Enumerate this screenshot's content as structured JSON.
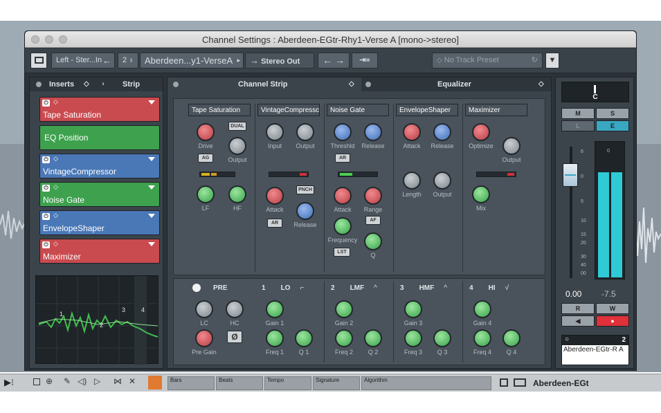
{
  "window": {
    "title": "Channel Settings : Aberdeen-EGtr-Rhy1-Verse A [mono->stereo]"
  },
  "toolbar": {
    "input_routing": "Left - Ster...In",
    "channel_number": "2",
    "channel_name": "Aberdeen...y1-VerseA",
    "output_routing": "Stereo Out",
    "track_preset": "No Track Preset"
  },
  "inserts_panel": {
    "tab_inserts": "Inserts",
    "tab_strip": "Strip",
    "slots": [
      {
        "name": "Tape Saturation",
        "color": "#c94a4f",
        "kind": "plugin"
      },
      {
        "name": "EQ Position",
        "color": "#3ea14e",
        "kind": "marker"
      },
      {
        "name": "VintageCompressor",
        "color": "#4a78b7",
        "kind": "plugin"
      },
      {
        "name": "Noise Gate",
        "color": "#3ea14e",
        "kind": "plugin"
      },
      {
        "name": "EnvelopeShaper",
        "color": "#4a78b7",
        "kind": "plugin"
      },
      {
        "name": "Maximizer",
        "color": "#c94a4f",
        "kind": "plugin"
      }
    ],
    "curve_points": [
      "1",
      "2",
      "3",
      "4"
    ]
  },
  "channel_strip": {
    "tab_label": "Channel Strip",
    "modules": [
      {
        "title": "Tape Saturation",
        "color": "#c94a4f",
        "knobs": [
          "Drive",
          "Output",
          "LF",
          "HF"
        ],
        "buttons": [
          "DUAL",
          "AG"
        ]
      },
      {
        "title": "VintageCompressc",
        "color": "#4a78b7",
        "knobs": [
          "Input",
          "Output",
          "Attack",
          "Release"
        ],
        "buttons": [
          "PNCH",
          "AR"
        ]
      },
      {
        "title": "Noise Gate",
        "color": "#3ea14e",
        "knobs": [
          "Threshld",
          "Release",
          "Attack",
          "Range",
          "Frequency",
          "Q"
        ],
        "buttons": [
          "AR",
          "AF",
          "LST"
        ]
      },
      {
        "title": "EnvelopeShaper",
        "color": "#4a78b7",
        "knobs": [
          "Attack",
          "Release",
          "Length",
          "Output"
        ],
        "buttons": []
      },
      {
        "title": "Maximizer",
        "color": "#c94a4f",
        "knobs": [
          "Optimize",
          "Output",
          "Mix"
        ],
        "buttons": []
      }
    ],
    "pre_section": {
      "label": "PRE",
      "knobs": [
        "LC",
        "HC",
        "Pre Gain"
      ],
      "phase_symbol": "Ø"
    },
    "eq_bands": [
      {
        "num": "1",
        "name": "LO",
        "knobs": [
          "Gain 1",
          "Freq 1",
          "Q 1"
        ]
      },
      {
        "num": "2",
        "name": "LMF",
        "knobs": [
          "Gain 2",
          "Freq 2",
          "Q 2"
        ]
      },
      {
        "num": "3",
        "name": "HMF",
        "knobs": [
          "Gain 3",
          "Freq 3",
          "Q 3"
        ]
      },
      {
        "num": "4",
        "name": "HI",
        "knobs": [
          "Gain 4",
          "Freq 4",
          "Q 4"
        ]
      }
    ]
  },
  "equalizer": {
    "tab_label": "Equalizer"
  },
  "fader_strip": {
    "pan_label": "C",
    "button_m": "M",
    "button_s": "S",
    "button_l": "L",
    "button_e": "E",
    "scale_left": [
      "6",
      "0",
      "5",
      "10",
      "15",
      "20",
      "30",
      "40",
      "00"
    ],
    "scale_right": [
      "0",
      "6"
    ],
    "volume_value": "0.00",
    "peak_value": "-7.5",
    "button_r": "R",
    "button_w": "W",
    "channel_num": "2",
    "channel_name": "Aberdeen-EGtr-R A",
    "colors": {
      "meter": "#2ecbd6",
      "record": "#e0303a",
      "eq_button": "#3aa7c2"
    }
  },
  "transport": {
    "bars_label": "Bars",
    "beats_label": "Beats",
    "tempo_label": "Tempo",
    "signature_label": "Signature",
    "algorithm_label": "Algorithm",
    "track_name": "Aberdeen-EGt"
  }
}
